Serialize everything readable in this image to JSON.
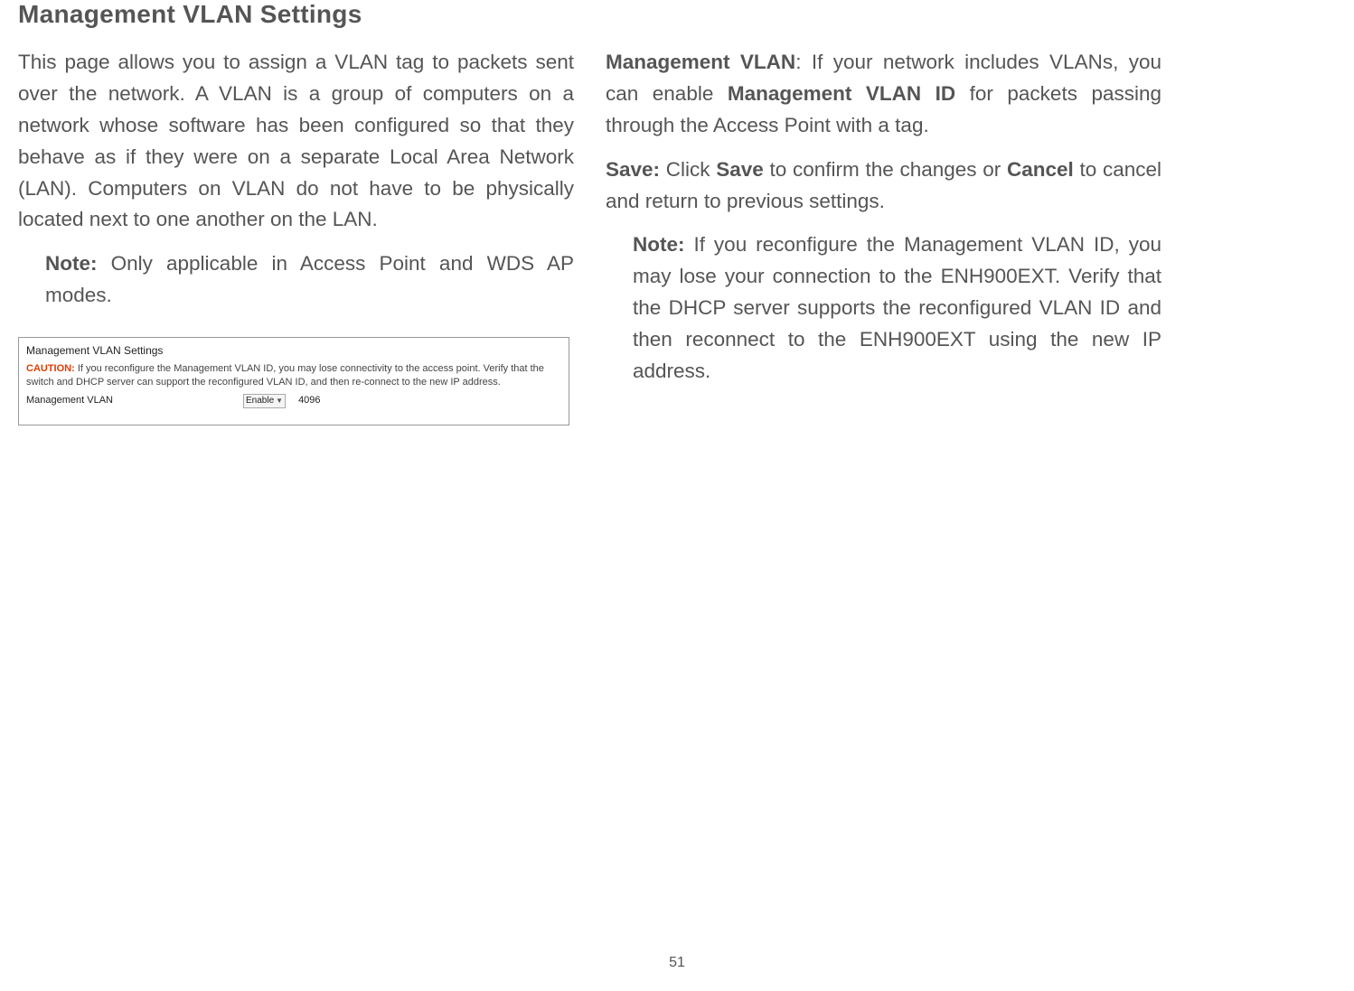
{
  "title": "Management VLAN Settings",
  "left": {
    "intro": "This page allows you to assign a VLAN tag to packets sent over the network. A VLAN is a group of computers on a network whose software has been configured so that they behave as if they were on a separate Local Area Network (LAN). Computers on VLAN do not have to be physically located next to one another on the LAN.",
    "note_label": "Note:",
    "note_text": " Only applicable in Access Point and WDS AP modes.",
    "screenshot": {
      "heading": "Management VLAN Settings",
      "caution_label": "CAUTION:",
      "caution_text": " If you reconfigure the Management VLAN ID, you may lose connectivity to the access point. Verify that the switch and DHCP server can support the reconfigured VLAN ID, and then re-connect to the new IP address.",
      "row_label": "Management VLAN",
      "dropdown_value": "Enable",
      "vlan_id_value": "4096"
    }
  },
  "right": {
    "mgmt_vlan_label": "Management VLAN",
    "mgmt_vlan_text_pre": ": If your network includes VLANs, you can enable ",
    "mgmt_vlan_bold": "Management VLAN ID",
    "mgmt_vlan_text_post": " for packets passing through the Access Point with a tag.",
    "save_label": "Save:",
    "save_text_pre": " Click ",
    "save_bold1": "Save",
    "save_text_mid": " to confirm the changes or ",
    "save_bold2": "Cancel",
    "save_text_post": " to cancel and return to previous settings.",
    "note_label": "Note:",
    "note_text": " If you reconfigure the Management VLAN ID, you may lose your connection to the ENH900EXT. Verify that the DHCP server supports the reconfigured VLAN ID and then reconnect to the ENH900EXT using the new IP address."
  },
  "page_number": "51"
}
